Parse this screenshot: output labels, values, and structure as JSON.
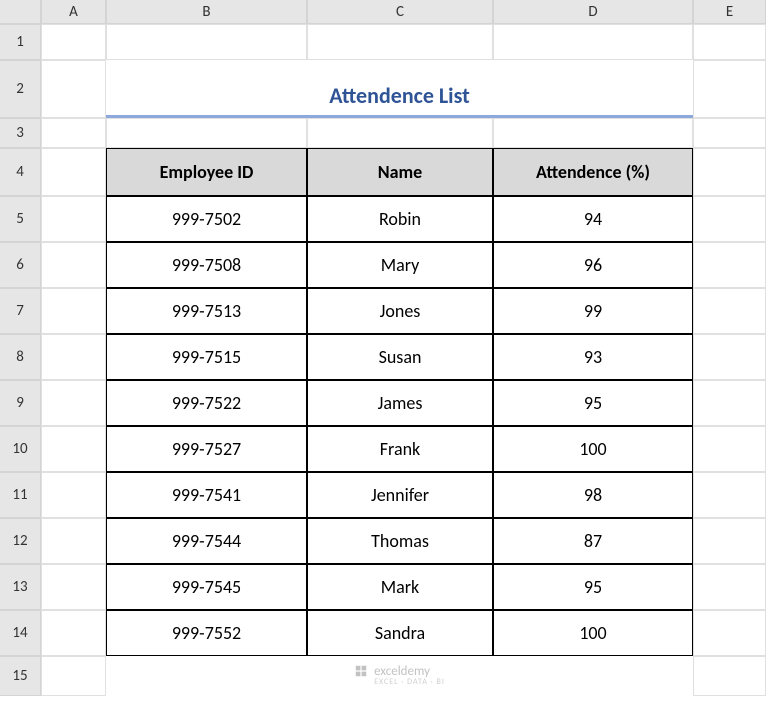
{
  "columns": [
    "A",
    "B",
    "C",
    "D",
    "E"
  ],
  "rows": [
    "1",
    "2",
    "3",
    "4",
    "5",
    "6",
    "7",
    "8",
    "9",
    "10",
    "11",
    "12",
    "13",
    "14",
    "15"
  ],
  "title": "Attendence List",
  "headers": {
    "id": "Employee ID",
    "name": "Name",
    "att": "Attendence (%)"
  },
  "data": [
    {
      "id": "999-7502",
      "name": "Robin",
      "att": "94"
    },
    {
      "id": "999-7508",
      "name": "Mary",
      "att": "96"
    },
    {
      "id": "999-7513",
      "name": "Jones",
      "att": "99"
    },
    {
      "id": "999-7515",
      "name": "Susan",
      "att": "93"
    },
    {
      "id": "999-7522",
      "name": "James",
      "att": "95"
    },
    {
      "id": "999-7527",
      "name": "Frank",
      "att": "100"
    },
    {
      "id": "999-7541",
      "name": "Jennifer",
      "att": "98"
    },
    {
      "id": "999-7544",
      "name": "Thomas",
      "att": "87"
    },
    {
      "id": "999-7545",
      "name": "Mark",
      "att": "95"
    },
    {
      "id": "999-7552",
      "name": "Sandra",
      "att": "100"
    }
  ],
  "watermark": {
    "brand": "exceldemy",
    "tag": "EXCEL · DATA · BI"
  }
}
